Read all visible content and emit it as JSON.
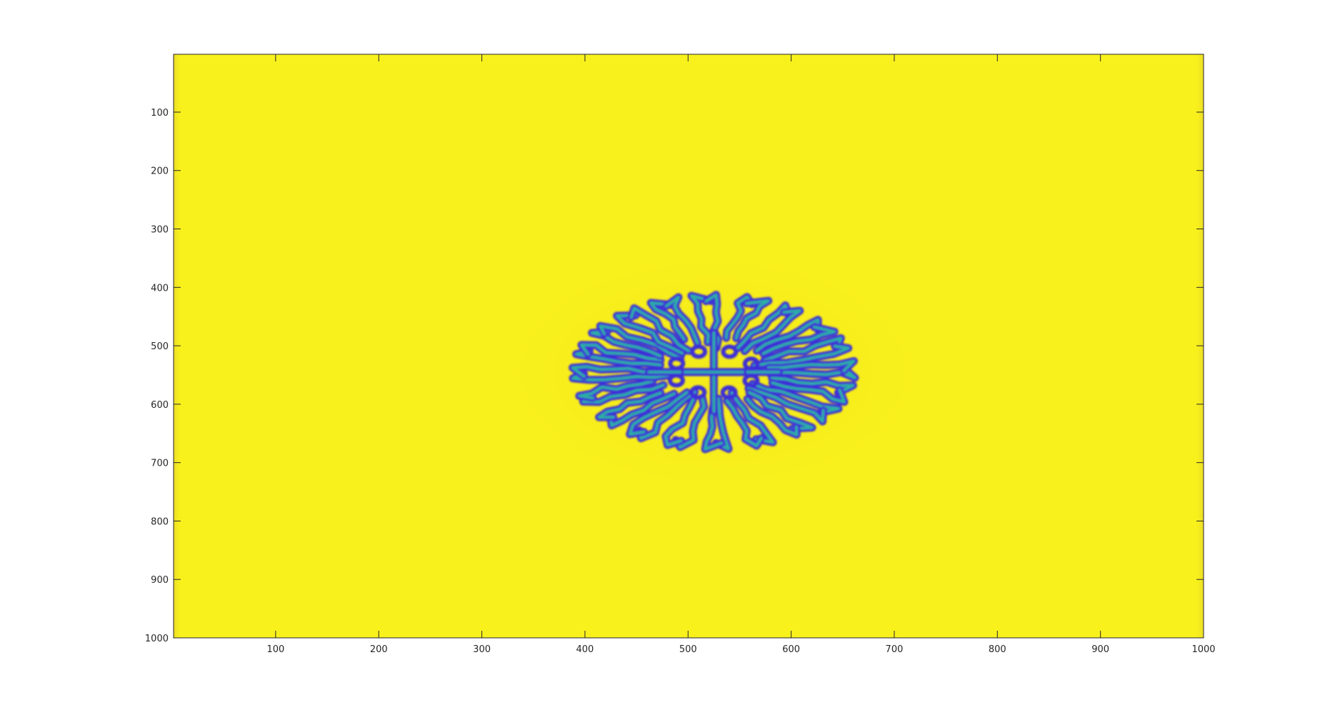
{
  "chart_data": {
    "type": "heatmap",
    "title": "",
    "xlabel": "",
    "ylabel": "",
    "colormap": "parula",
    "background_color": "#f9f11c",
    "pattern_colors": {
      "low": "#3e2fd6",
      "mid": "#2ab2a0",
      "high": "#f9f11c",
      "halo": "#f4ea1a"
    },
    "xlim": [
      1,
      1000
    ],
    "ylim": [
      1,
      1000
    ],
    "y_direction": "reverse",
    "x_ticks": [
      100,
      200,
      300,
      400,
      500,
      600,
      700,
      800,
      900,
      1000
    ],
    "y_ticks": [
      100,
      200,
      300,
      400,
      500,
      600,
      700,
      800,
      900,
      1000
    ],
    "grid": false,
    "feature": {
      "description": "labyrinthine blue/teal spot pattern",
      "center": [
        525,
        545
      ],
      "radius_x": 140,
      "radius_y": 135
    }
  }
}
